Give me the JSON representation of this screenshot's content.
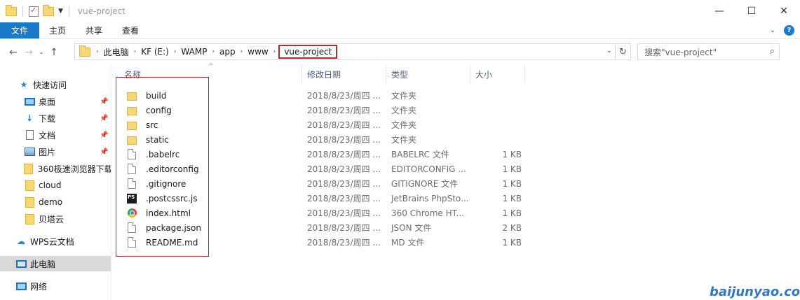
{
  "window": {
    "title": "vue-project",
    "controls": {
      "minimize": "—",
      "maximize": "☐",
      "close": "✕"
    }
  },
  "ribbon": {
    "tabs": [
      "文件",
      "主页",
      "共享",
      "查看"
    ],
    "expand_icon": "chevron-down-icon",
    "help_icon": "?"
  },
  "address": {
    "breadcrumbs": [
      "此电脑",
      "KF (E:)",
      "WAMP",
      "app",
      "www",
      "vue-project"
    ],
    "search_placeholder": "搜索\"vue-project\""
  },
  "sidebar": {
    "items": [
      {
        "label": "快速访问",
        "icon": "star-icon",
        "pinned": false
      },
      {
        "label": "桌面",
        "icon": "desktop-icon",
        "pinned": true
      },
      {
        "label": "下载",
        "icon": "download-icon",
        "pinned": true
      },
      {
        "label": "文档",
        "icon": "document-icon",
        "pinned": true
      },
      {
        "label": "图片",
        "icon": "pictures-icon",
        "pinned": true
      },
      {
        "label": "360极速浏览器下载",
        "icon": "folder-icon",
        "pinned": false
      },
      {
        "label": "cloud",
        "icon": "folder-icon",
        "pinned": false
      },
      {
        "label": "demo",
        "icon": "folder-icon",
        "pinned": false
      },
      {
        "label": "贝塔云",
        "icon": "folder-icon",
        "pinned": false
      },
      {
        "label": "WPS云文档",
        "icon": "cloud-icon",
        "pinned": false
      },
      {
        "label": "此电脑",
        "icon": "computer-icon",
        "pinned": false,
        "selected": true
      },
      {
        "label": "网络",
        "icon": "network-icon",
        "pinned": false
      }
    ]
  },
  "filelist": {
    "columns": [
      "名称",
      "修改日期",
      "类型",
      "大小"
    ],
    "rows": [
      {
        "name": "build",
        "date": "2018/8/23/周四 ...",
        "type": "文件夹",
        "size": "",
        "icon": "folder-icon"
      },
      {
        "name": "config",
        "date": "2018/8/23/周四 ...",
        "type": "文件夹",
        "size": "",
        "icon": "folder-icon"
      },
      {
        "name": "src",
        "date": "2018/8/23/周四 ...",
        "type": "文件夹",
        "size": "",
        "icon": "folder-icon"
      },
      {
        "name": "static",
        "date": "2018/8/23/周四 ...",
        "type": "文件夹",
        "size": "",
        "icon": "folder-icon"
      },
      {
        "name": ".babelrc",
        "date": "2018/8/23/周四 ...",
        "type": "BABELRC 文件",
        "size": "1 KB",
        "icon": "file-icon"
      },
      {
        "name": ".editorconfig",
        "date": "2018/8/23/周四 ...",
        "type": "EDITORCONFIG ...",
        "size": "1 KB",
        "icon": "file-icon"
      },
      {
        "name": ".gitignore",
        "date": "2018/8/23/周四 ...",
        "type": "GITIGNORE 文件",
        "size": "1 KB",
        "icon": "file-icon"
      },
      {
        "name": ".postcssrc.js",
        "date": "2018/8/23/周四 ...",
        "type": "JetBrains PhpSto...",
        "size": "1 KB",
        "icon": "phpstorm-icon"
      },
      {
        "name": "index.html",
        "date": "2018/8/23/周四 ...",
        "type": "360 Chrome HT...",
        "size": "1 KB",
        "icon": "chrome-icon"
      },
      {
        "name": "package.json",
        "date": "2018/8/23/周四 ...",
        "type": "JSON 文件",
        "size": "2 KB",
        "icon": "file-icon"
      },
      {
        "name": "README.md",
        "date": "2018/8/23/周四 ...",
        "type": "MD 文件",
        "size": "1 KB",
        "icon": "file-icon"
      }
    ]
  },
  "watermark": "baijunyao.com"
}
